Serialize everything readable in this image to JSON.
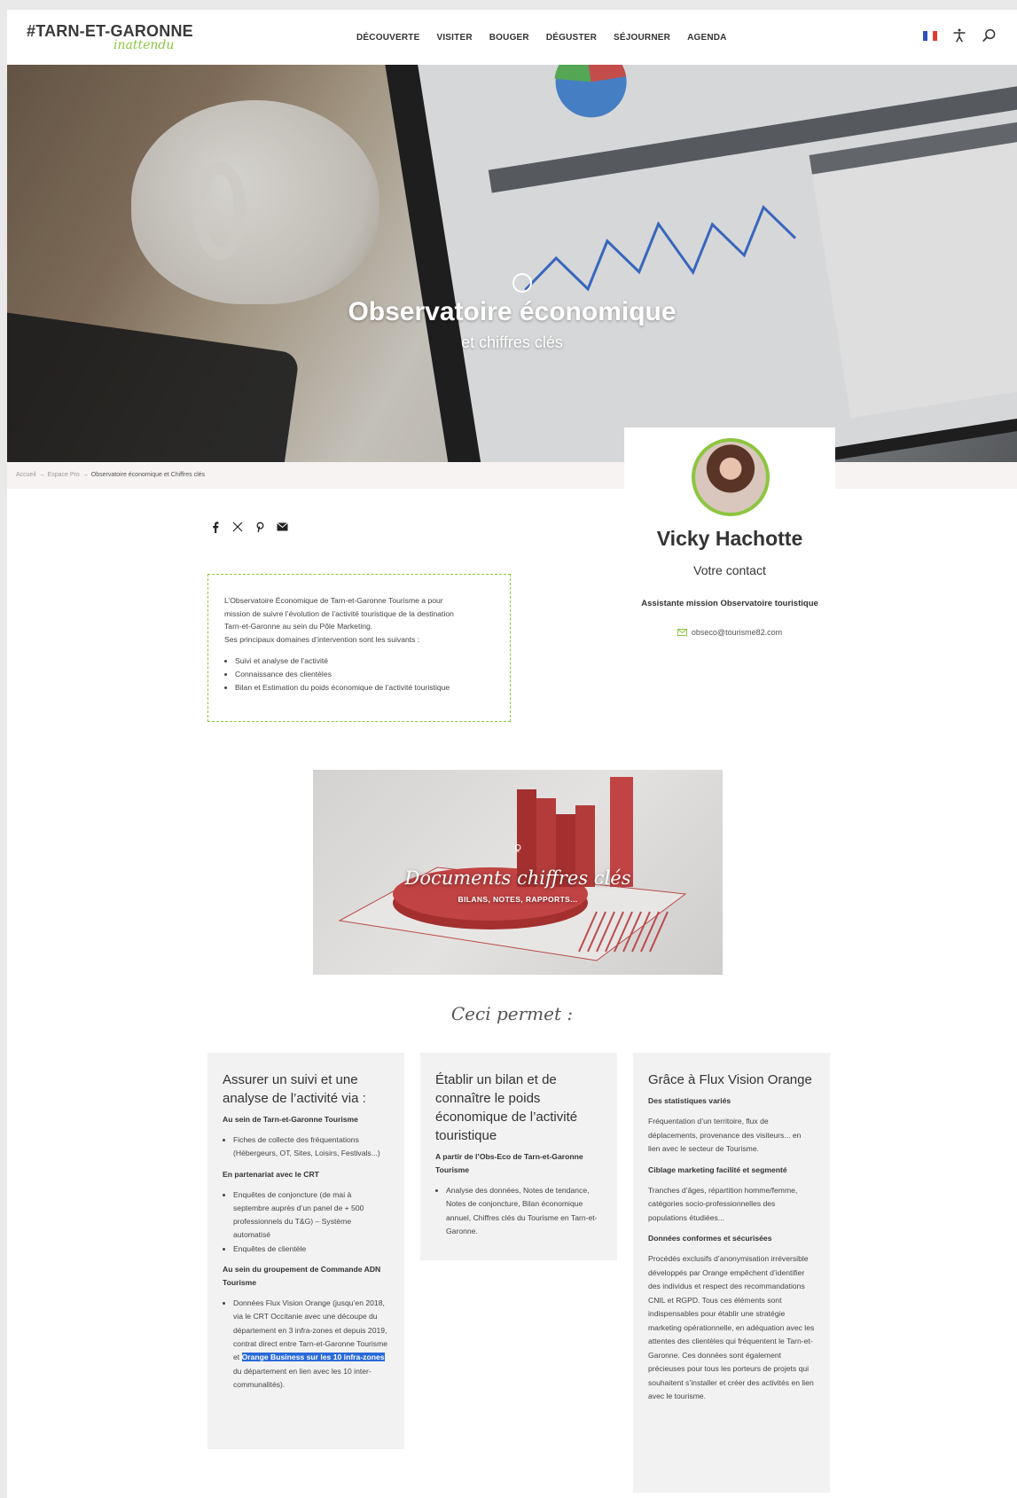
{
  "header": {
    "logo_main": "#TARN-ET-GARONNE",
    "logo_sub": "inattendu",
    "nav": [
      "DÉCOUVERTE",
      "VISITER",
      "BOUGER",
      "DÉGUSTER",
      "SÉJOURNER",
      "AGENDA"
    ],
    "flag_colors": [
      "#2a52be",
      "#ffffff",
      "#e03c31"
    ],
    "icons": [
      "flag-fr-icon",
      "accessibility-icon",
      "search-icon"
    ]
  },
  "hero": {
    "title": "Observatoire économique",
    "subtitle": "et chiffres clés"
  },
  "breadcrumb": {
    "items": [
      "Accueil",
      "Espace Pro"
    ],
    "separator": "→",
    "current": "Observatoire économique et Chiffres clés"
  },
  "share": [
    "facebook-icon",
    "x-icon",
    "pinterest-icon",
    "mail-icon"
  ],
  "intro": {
    "lines": [
      "L’Observatoire Économique de Tarn-et-Garonne Tourisme a pour",
      "mission de suivre l’évolution de l’activité touristique de la destination",
      "Tarn-et-Garonne au sein du Pôle Marketing.",
      "Ses principaux domaines d’intervention sont les suivants :"
    ],
    "items": [
      "Suivi et analyse de l’activité",
      "Connaissance des clientèles",
      "Bilan et Estimation du poids économique de l’activité touristique"
    ]
  },
  "contact": {
    "name": "Vicky Hachotte",
    "role_title": "Votre contact",
    "role": "Assistante mission Observatoire touristique",
    "email": "obseco@tourisme82.com"
  },
  "docs": {
    "title": "Documents chiffres clés",
    "subtitle": "BILANS, NOTES, RAPPORTS..."
  },
  "ceci": "Ceci permet :",
  "col1": {
    "title": "Assurer un suivi et une analyse de l’activité via :",
    "h1": "Au sein de Tarn-et-Garonne Tourisme",
    "list1": [
      "Fiches de collecte des fréquentations (Hébergeurs, OT, Sites, Loisirs, Festivals...)"
    ],
    "h2": "En partenariat avec le CRT",
    "list2": [
      "Enquêtes de conjoncture (de mai à septembre auprès d’un panel de + 500 professionnels du T&G) – Système automatisé",
      "Enquêtes de clientèle"
    ],
    "h3": "Au sein du groupement de Commande ADN Tourisme",
    "last_item_a": "Données Flux Vision Orange (jusqu’en 2018, via le CRT Occitanie avec une découpe du département en 3 infra-zones et depuis 2019, contrat direct entre Tarn-et-Garonne Tourisme et ",
    "last_item_highlight": "Orange Business sur les 10 infra-zones",
    "last_item_b": " du département en lien avec les 10 inter-communalités)."
  },
  "col2": {
    "title": "Établir un bilan et de connaître le poids économique de l’activité touristique",
    "h1": "A partir de l’Obs-Eco de Tarn-et-Garonne Tourisme",
    "list1": [
      "Analyse des données, Notes de tendance, Notes de conjoncture, Bilan économique annuel, Chiffres clés du Tourisme en Tarn-et-Garonne."
    ]
  },
  "col3": {
    "title": "Grâce à Flux Vision Orange",
    "h1": "Des statistiques variés",
    "p1": "Fréquentation d’un territoire, flux de déplacements, provenance des visiteurs... en lien avec le secteur de Tourisme.",
    "h2": "Ciblage marketing facilité et segmenté",
    "p2": "Tranches d’âges, répartition homme/femme, catégories socio-professionnelles des populations étudiées...",
    "h3": "Données conformes et sécurisées",
    "p3": "Procédés exclusifs d’anonymisation irréversible développés par Orange empêchent d’identifier des individus et respect des recommandations CNIL et RGPD. Tous ces éléments sont indispensables pour établir une stratégie marketing opérationnelle, en adéquation avec les attentes des clientèles qui fréquentent le Tarn-et-Garonne. Ces données sont également précieuses pour tous les porteurs de projets qui souhaitent s’installer et créer des activités en lien avec le tourisme."
  }
}
